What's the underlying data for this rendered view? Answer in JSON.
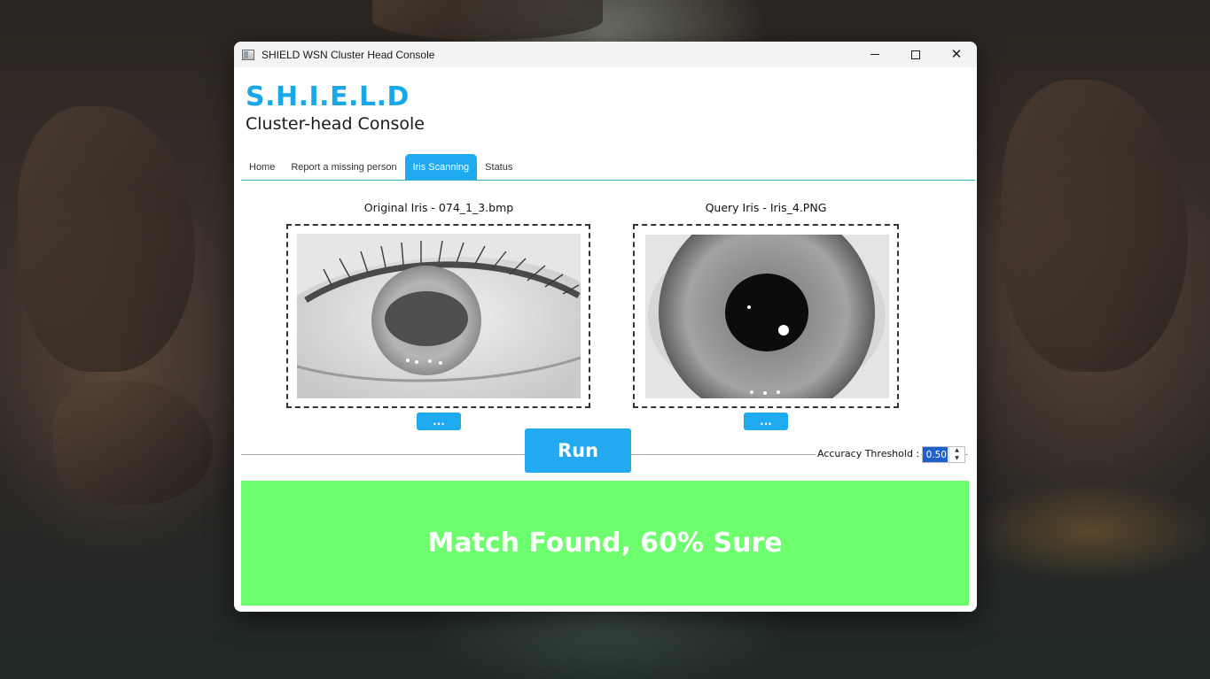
{
  "window": {
    "title": "SHIELD WSN Cluster Head Console",
    "controls": {
      "minimize": "minimize",
      "maximize": "maximize",
      "close": "✕"
    }
  },
  "brand": {
    "title": "S.H.I.E.L.D",
    "subtitle": "Cluster-head Console",
    "accent_color": "#1aa7e8"
  },
  "tabs": [
    {
      "label": "Home",
      "active": false
    },
    {
      "label": "Report a missing person",
      "active": false
    },
    {
      "label": "Iris Scanning",
      "active": true
    },
    {
      "label": "Status",
      "active": false
    }
  ],
  "original": {
    "label": "Original Iris - 074_1_3.bmp",
    "browse_label": "..."
  },
  "query": {
    "label": "Query Iris - Iris_4.PNG",
    "browse_label": "..."
  },
  "run_label": "Run",
  "threshold": {
    "label": "Accuracy Threshold :",
    "value": "0.50"
  },
  "result": {
    "text": "Match Found, 60% Sure",
    "color": "#6dff6d"
  }
}
